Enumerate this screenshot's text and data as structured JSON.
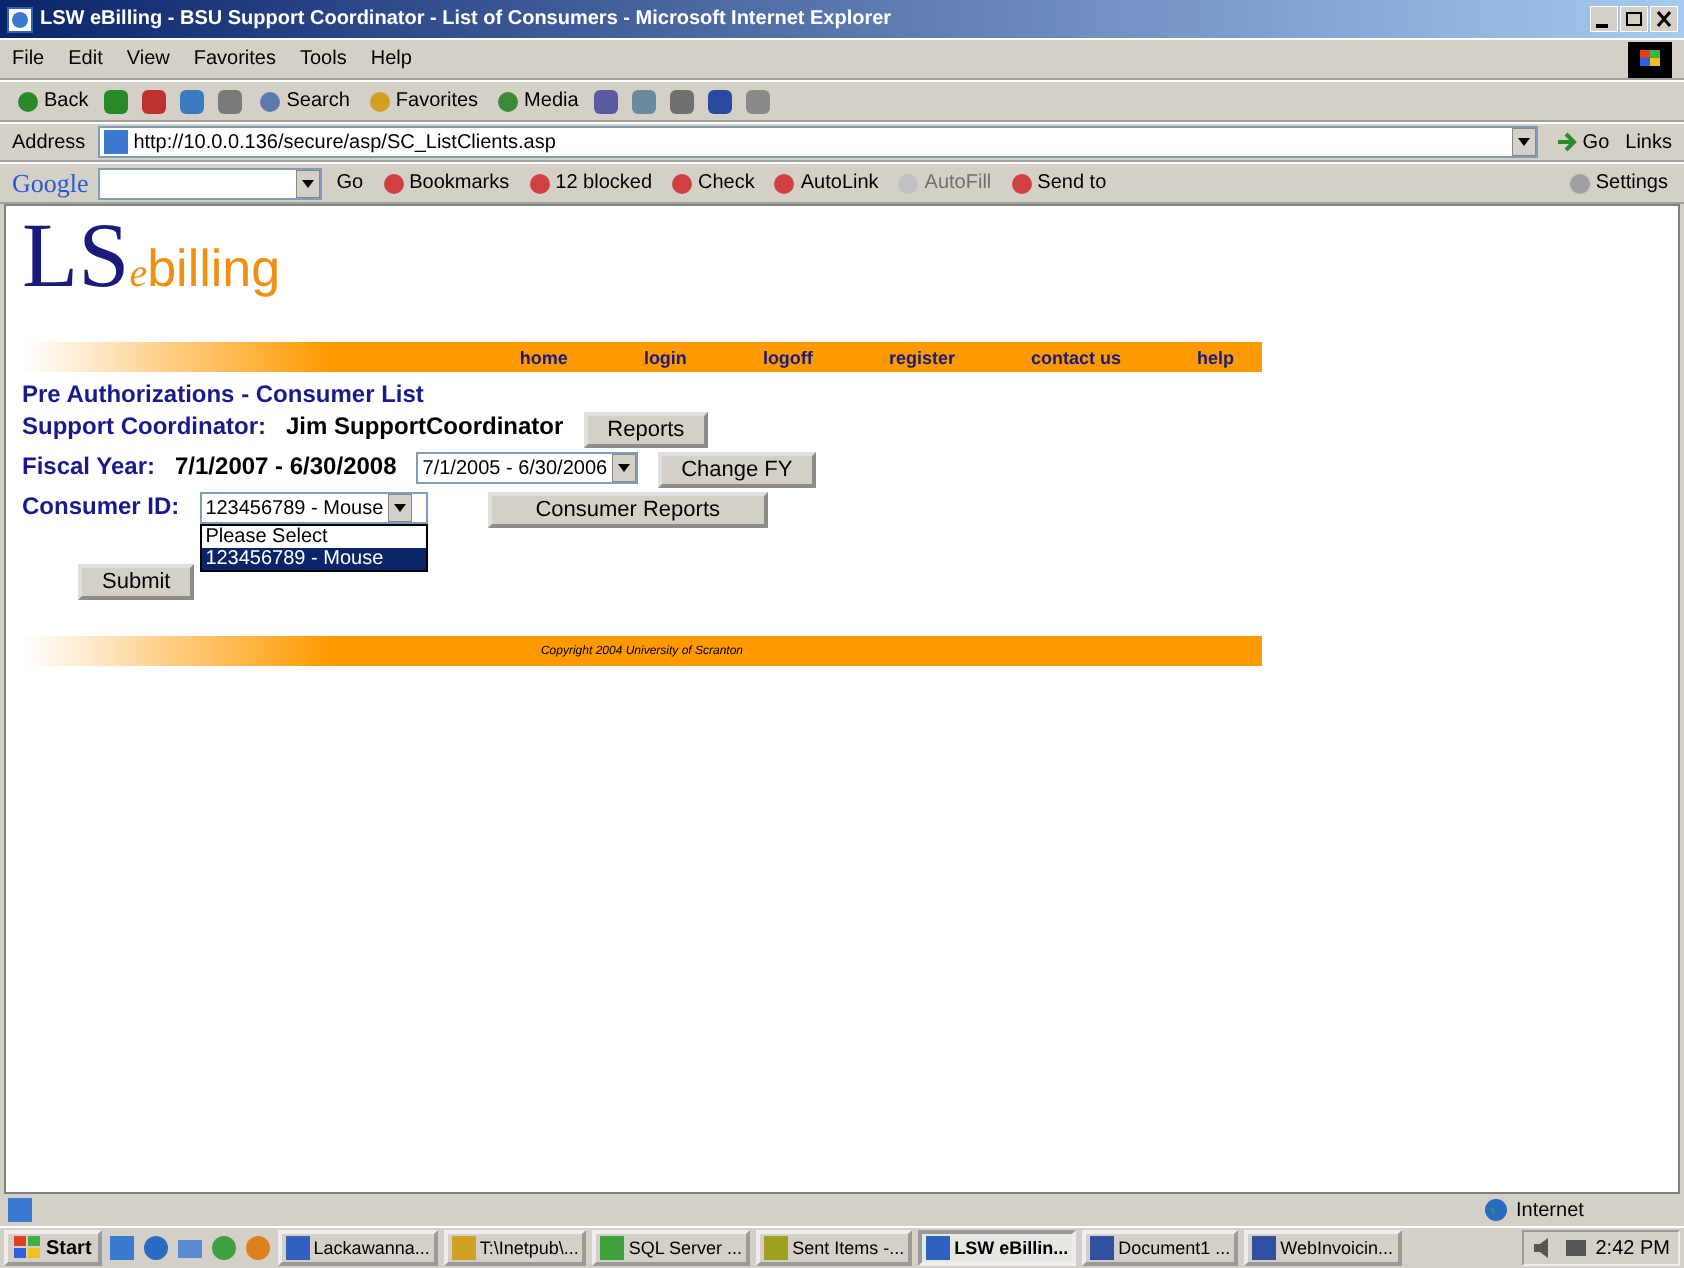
{
  "window": {
    "title": "LSW eBilling - BSU Support Coordinator - List of Consumers - Microsoft Internet Explorer"
  },
  "menu": [
    "File",
    "Edit",
    "View",
    "Favorites",
    "Tools",
    "Help"
  ],
  "toolbar": [
    {
      "kind": "back",
      "label": "Back"
    },
    {
      "kind": "forward"
    },
    {
      "kind": "stop"
    },
    {
      "kind": "refresh"
    },
    {
      "kind": "home"
    },
    {
      "kind": "search",
      "label": "Search"
    },
    {
      "kind": "favorites",
      "label": "Favorites"
    },
    {
      "kind": "media",
      "label": "Media"
    },
    {
      "kind": "history"
    },
    {
      "kind": "mail"
    },
    {
      "kind": "print"
    },
    {
      "kind": "word"
    },
    {
      "kind": "notes"
    }
  ],
  "address": {
    "label": "Address",
    "value": "http://10.0.0.136/secure/asp/SC_ListClients.asp",
    "go": "Go",
    "links": "Links"
  },
  "google": {
    "logo": "Google",
    "go": "Go",
    "items": [
      {
        "label": "Bookmarks",
        "disabled": false
      },
      {
        "label": "12 blocked",
        "disabled": false
      },
      {
        "label": "Check",
        "disabled": false
      },
      {
        "label": "AutoLink",
        "disabled": false
      },
      {
        "label": "AutoFill",
        "disabled": true
      },
      {
        "label": "Send to",
        "disabled": false
      }
    ],
    "settings": "Settings"
  },
  "logo": {
    "big": "LS",
    "small": "e",
    "rest": "billing"
  },
  "nav": [
    "home",
    "login",
    "logoff",
    "register",
    "contact us",
    "help"
  ],
  "page": {
    "heading": "Pre Authorizations - Consumer List",
    "coordinator_label": "Support Coordinator:",
    "coordinator": "Jim SupportCoordinator",
    "reports": "Reports",
    "fiscal_label": "Fiscal Year:",
    "fiscal": "7/1/2007 - 6/30/2008",
    "fy_select": "7/1/2005 - 6/30/2006",
    "change_fy": "Change FY",
    "consumer_label": "Consumer ID:",
    "consumer_select": "123456789 - Mouse",
    "consumer_reports": "Consumer Reports",
    "options": [
      {
        "label": "Please Select",
        "selected": false
      },
      {
        "label": "123456789 - Mouse",
        "selected": true
      }
    ],
    "submit": "Submit",
    "copyright": "Copyright 2004   University of Scranton"
  },
  "status": {
    "zone": "Internet"
  },
  "taskbar": {
    "start": "Start",
    "tasks": [
      {
        "label": "Lackawanna...",
        "selected": false
      },
      {
        "label": "T:\\Inetpub\\...",
        "selected": false
      },
      {
        "label": "SQL Server ...",
        "selected": false
      },
      {
        "label": "Sent Items -...",
        "selected": false
      },
      {
        "label": "LSW eBillin...",
        "selected": true
      },
      {
        "label": "Document1 ...",
        "selected": false
      },
      {
        "label": "WebInvoicin...",
        "selected": false
      }
    ],
    "clock": "2:42 PM"
  }
}
